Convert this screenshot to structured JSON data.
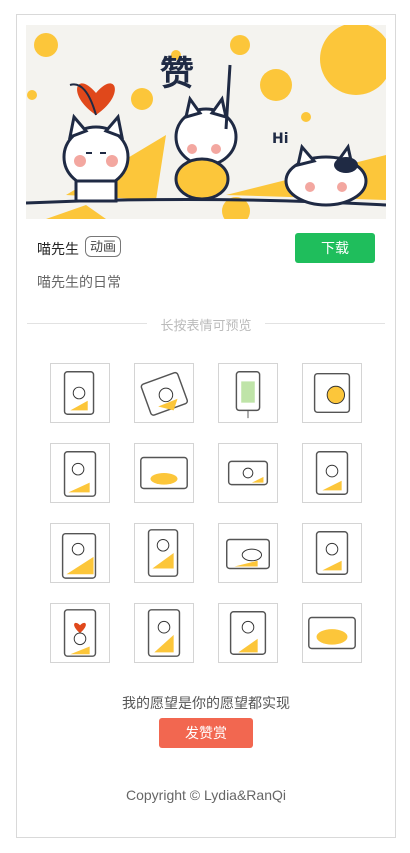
{
  "banner": {
    "alt": "喵先生 banner",
    "praise_text": "赞",
    "hi_text": "Hi"
  },
  "sticker_pack": {
    "title": "喵先生",
    "badge": "动画",
    "download_label": "下载",
    "subtitle": "喵先生的日常"
  },
  "preview_hint": "长按表情可预览",
  "stickers": [
    {
      "name": "sticker-1"
    },
    {
      "name": "sticker-2"
    },
    {
      "name": "sticker-3"
    },
    {
      "name": "sticker-4"
    },
    {
      "name": "sticker-5"
    },
    {
      "name": "sticker-6"
    },
    {
      "name": "sticker-7"
    },
    {
      "name": "sticker-8"
    },
    {
      "name": "sticker-9"
    },
    {
      "name": "sticker-10"
    },
    {
      "name": "sticker-11"
    },
    {
      "name": "sticker-12"
    },
    {
      "name": "sticker-13"
    },
    {
      "name": "sticker-14"
    },
    {
      "name": "sticker-15"
    },
    {
      "name": "sticker-16"
    }
  ],
  "reward": {
    "wish_text": "我的愿望是你的愿望都实现",
    "button_label": "发赞赏"
  },
  "footer": {
    "copyright": "Copyright © Lydia&RanQi"
  },
  "colors": {
    "accent_green": "#1fbe5c",
    "reward_red": "#f26750",
    "cat_yellow": "#fcc63a",
    "heart_red": "#e0481b"
  }
}
